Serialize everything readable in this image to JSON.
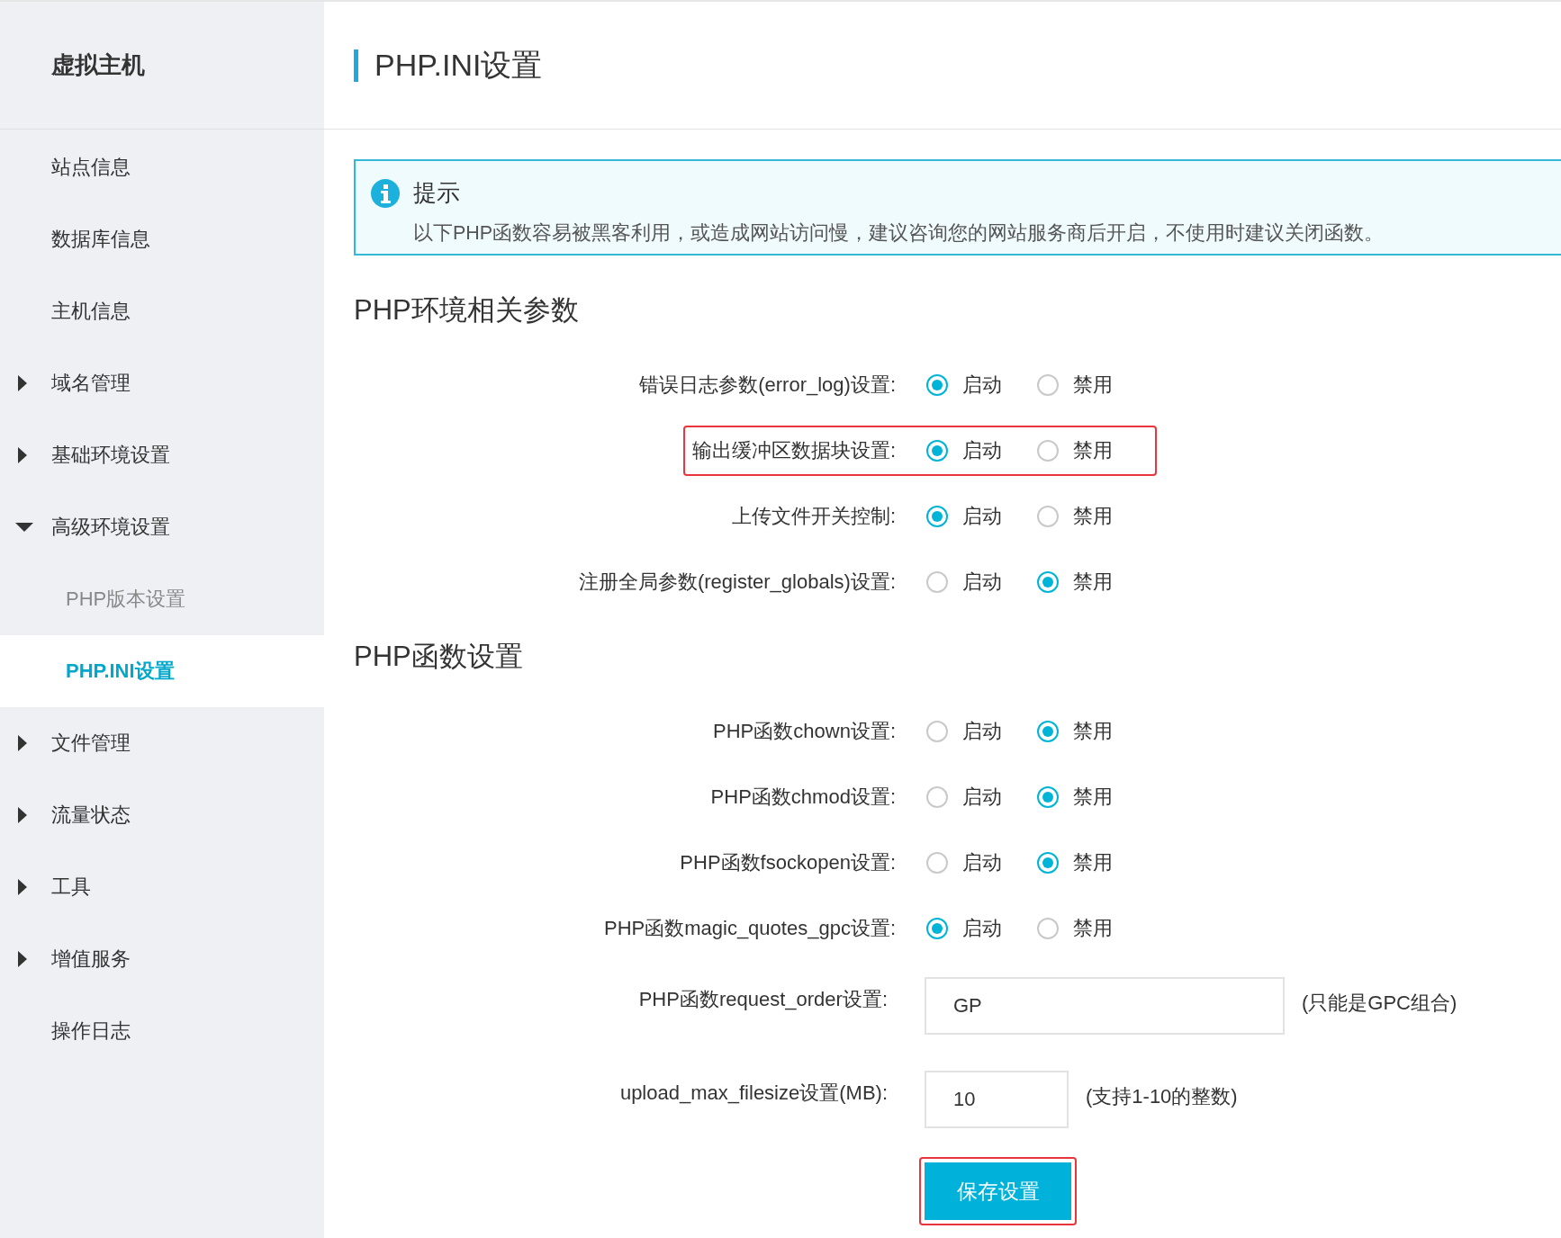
{
  "sidebar": {
    "title": "虚拟主机",
    "items": [
      {
        "kind": "link",
        "label": "站点信息",
        "selected": false
      },
      {
        "kind": "link",
        "label": "数据库信息",
        "selected": false
      },
      {
        "kind": "link",
        "label": "主机信息",
        "selected": false
      },
      {
        "kind": "group",
        "label": "域名管理",
        "expanded": false
      },
      {
        "kind": "group",
        "label": "基础环境设置",
        "expanded": false
      },
      {
        "kind": "group",
        "label": "高级环境设置",
        "expanded": true,
        "children": [
          {
            "label": "PHP版本设置",
            "selected": false
          },
          {
            "label": "PHP.INI设置",
            "selected": true
          }
        ]
      },
      {
        "kind": "group",
        "label": "文件管理",
        "expanded": false
      },
      {
        "kind": "group",
        "label": "流量状态",
        "expanded": false
      },
      {
        "kind": "group",
        "label": "工具",
        "expanded": false
      },
      {
        "kind": "group",
        "label": "增值服务",
        "expanded": false
      },
      {
        "kind": "link",
        "label": "操作日志",
        "selected": false
      }
    ]
  },
  "page_title": "PHP.INI设置",
  "tip": {
    "title": "提示",
    "text": "以下PHP函数容易被黑客利用，或造成网站访问慢，建议咨询您的网站服务商后开启，不使用时建议关闭函数。"
  },
  "sections": [
    {
      "title": "PHP环境相关参数",
      "rows": [
        {
          "kind": "radio",
          "label": "错误日志参数(error_log)设置:",
          "highlighted": false,
          "options": [
            {
              "label": "启动",
              "selected": true
            },
            {
              "label": "禁用",
              "selected": false
            }
          ]
        },
        {
          "kind": "radio",
          "label": "输出缓冲区数据块设置:",
          "highlighted": true,
          "options": [
            {
              "label": "启动",
              "selected": true
            },
            {
              "label": "禁用",
              "selected": false
            }
          ]
        },
        {
          "kind": "radio",
          "label": "上传文件开关控制:",
          "highlighted": false,
          "options": [
            {
              "label": "启动",
              "selected": true
            },
            {
              "label": "禁用",
              "selected": false
            }
          ]
        },
        {
          "kind": "radio",
          "label": "注册全局参数(register_globals)设置:",
          "highlighted": false,
          "options": [
            {
              "label": "启动",
              "selected": false
            },
            {
              "label": "禁用",
              "selected": true
            }
          ]
        }
      ]
    },
    {
      "title": "PHP函数设置",
      "rows": [
        {
          "kind": "radio",
          "label": "PHP函数chown设置:",
          "highlighted": false,
          "options": [
            {
              "label": "启动",
              "selected": false
            },
            {
              "label": "禁用",
              "selected": true
            }
          ]
        },
        {
          "kind": "radio",
          "label": "PHP函数chmod设置:",
          "highlighted": false,
          "options": [
            {
              "label": "启动",
              "selected": false
            },
            {
              "label": "禁用",
              "selected": true
            }
          ]
        },
        {
          "kind": "radio",
          "label": "PHP函数fsockopen设置:",
          "highlighted": false,
          "options": [
            {
              "label": "启动",
              "selected": false
            },
            {
              "label": "禁用",
              "selected": true
            }
          ]
        },
        {
          "kind": "radio",
          "label": "PHP函数magic_quotes_gpc设置:",
          "highlighted": false,
          "options": [
            {
              "label": "启动",
              "selected": true
            },
            {
              "label": "禁用",
              "selected": false
            }
          ]
        },
        {
          "kind": "textfield",
          "label": "PHP函数request_order设置:",
          "value": "GP",
          "hint": "(只能是GPC组合)"
        },
        {
          "kind": "numberfield",
          "label": "upload_max_filesize设置(MB):",
          "value": "10",
          "hint": "(支持1-10的整数)"
        }
      ]
    }
  ],
  "save_button": {
    "label": "保存设置",
    "highlighted": true
  }
}
